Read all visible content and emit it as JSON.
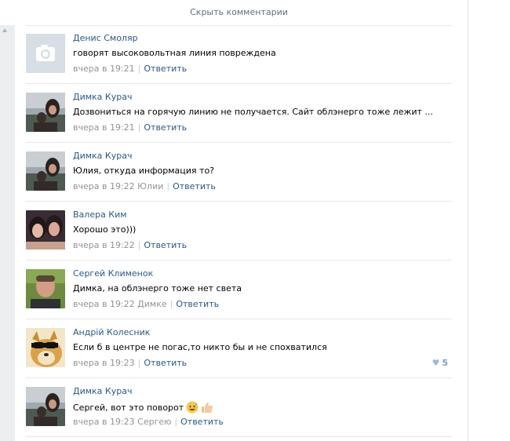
{
  "header": {
    "hide_comments_label": "Скрыть комментарии"
  },
  "reply_label": "Ответить",
  "colors": {
    "link": "#2a5885",
    "meta": "#939393",
    "divider": "#e7e8ec"
  },
  "comments": [
    {
      "author": "Денис Смоляр",
      "text": "говорят высоковольтная линия повреждена",
      "time": "вчера в 19:21",
      "reply_to": "",
      "avatar": "camera-placeholder"
    },
    {
      "author": "Димка Курач",
      "text": "Дозвониться на горячую линию не получается. Сайт облэнерго тоже лежит ...",
      "time": "вчера в 19:21",
      "reply_to": "",
      "avatar": "photo-couple"
    },
    {
      "author": "Димка Курач",
      "text": "Юлия, откуда информация то?",
      "time": "вчера в 19:22",
      "reply_to": "Юлии",
      "avatar": "photo-couple"
    },
    {
      "author": "Валера Ким",
      "text": "Хорошо это)))",
      "time": "вчера в 19:22",
      "reply_to": "",
      "avatar": "photo-girls"
    },
    {
      "author": "Сергей Клименок",
      "text": "Димка, на облэнерго тоже нет света",
      "time": "вчера в 19:22",
      "reply_to": "Димке",
      "avatar": "photo-man"
    },
    {
      "author": "Андрій Колесник",
      "text": "Если б в центре не погас,то никто бы и не спохватился",
      "time": "вчера в 19:23",
      "reply_to": "",
      "avatar": "doge",
      "likes": "5"
    },
    {
      "author": "Димка Курач",
      "text": "Сергей, вот это поворот",
      "time": "вчера в 19:23",
      "reply_to": "Сергею",
      "avatar": "photo-couple",
      "emoji": [
        "sweat-smile-emoji",
        "thumbs-up-emoji"
      ]
    }
  ]
}
